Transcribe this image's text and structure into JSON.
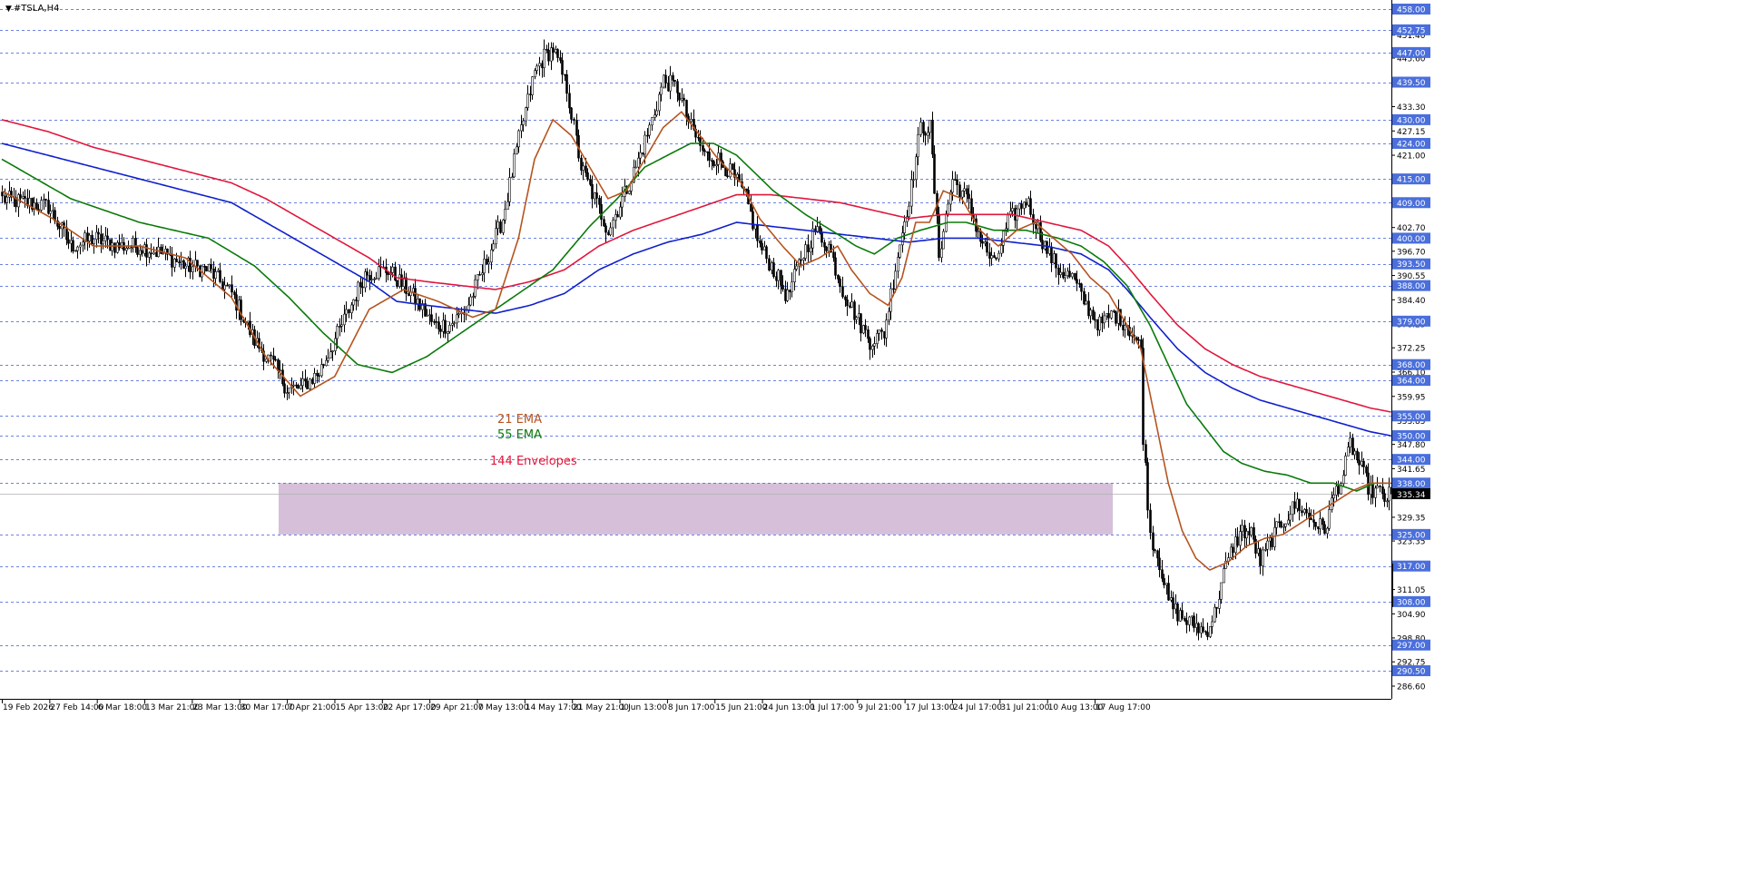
{
  "window": {
    "symbol_title": "#TSLA,H4"
  },
  "icons": {
    "title_marker": "triangle-down-icon"
  },
  "colors": {
    "background": "#ffffff",
    "grid_line": "#3b5bdb",
    "level_label_bg": "#4a6fdc",
    "level_label_text": "#ffffff",
    "candle": "#000000",
    "ema21": "#b5541f",
    "ema55": "#0a7a0a",
    "env_upper": "#e0173c",
    "env_lower": "#1020cc",
    "zone": "#d5bfd9",
    "current_price_bg": "#000000"
  },
  "chart_data": {
    "type": "candlestick",
    "symbol": "#TSLA",
    "timeframe": "H4",
    "ylim": [
      286.6,
      458.0
    ],
    "price_scale_ticks": [
      "451.40",
      "445.60",
      "433.30",
      "427.15",
      "421.00",
      "402.70",
      "396.70",
      "390.55",
      "384.40",
      "378.25",
      "372.25",
      "366.10",
      "359.95",
      "353.85",
      "347.80",
      "341.65",
      "329.35",
      "323.35",
      "311.05",
      "304.90",
      "298.80",
      "292.75",
      "286.60"
    ],
    "levels": [
      "458.00",
      "452.75",
      "447.00",
      "439.50",
      "430.00",
      "424.00",
      "415.00",
      "409.00",
      "400.00",
      "393.50",
      "388.00",
      "379.00",
      "368.00",
      "364.00",
      "355.00",
      "350.00",
      "344.00",
      "338.00",
      "325.00",
      "317.00",
      "308.00",
      "297.00",
      "290.50"
    ],
    "current_price": "335.34",
    "x_labels": [
      "19 Feb 2026",
      "27 Feb 14:00",
      "6 Mar 18:00",
      "13 Mar 21:00",
      "23 Mar 13:00",
      "30 Mar 17:00",
      "7 Apr 21:00",
      "15 Apr 13:00",
      "22 Apr 17:00",
      "29 Apr 21:00",
      "7 May 13:00",
      "14 May 17:00",
      "21 May 21:00",
      "1 Jun 13:00",
      "8 Jun 17:00",
      "15 Jun 21:00",
      "24 Jun 13:00",
      "1 Jul 17:00",
      "9 Jul 21:00",
      "17 Jul 13:00",
      "24 Jul 17:00",
      "31 Jul 21:00",
      "10 Aug 13:00",
      "17 Aug 17:00"
    ],
    "indicator_labels": [
      "21 EMA",
      "55 EMA",
      "144 Envelopes"
    ],
    "zone": {
      "low": 325.0,
      "high": 338.0
    },
    "close_anchors": [
      [
        0,
        410
      ],
      [
        20,
        408
      ],
      [
        30,
        398
      ],
      [
        40,
        400
      ],
      [
        50,
        398
      ],
      [
        60,
        398
      ],
      [
        70,
        396
      ],
      [
        80,
        393
      ],
      [
        90,
        392
      ],
      [
        100,
        386
      ],
      [
        110,
        374
      ],
      [
        118,
        368
      ],
      [
        124,
        362
      ],
      [
        130,
        362
      ],
      [
        138,
        366
      ],
      [
        148,
        378
      ],
      [
        158,
        391
      ],
      [
        168,
        392
      ],
      [
        178,
        386
      ],
      [
        188,
        378
      ],
      [
        195,
        378
      ],
      [
        202,
        382
      ],
      [
        210,
        393
      ],
      [
        218,
        405
      ],
      [
        225,
        425
      ],
      [
        232,
        442
      ],
      [
        236,
        446
      ],
      [
        240,
        448
      ],
      [
        246,
        438
      ],
      [
        252,
        418
      ],
      [
        258,
        410
      ],
      [
        264,
        402
      ],
      [
        270,
        410
      ],
      [
        276,
        418
      ],
      [
        282,
        428
      ],
      [
        288,
        440
      ],
      [
        294,
        438
      ],
      [
        300,
        428
      ],
      [
        306,
        421
      ],
      [
        312,
        420
      ],
      [
        318,
        416
      ],
      [
        324,
        410
      ],
      [
        330,
        398
      ],
      [
        336,
        392
      ],
      [
        342,
        385
      ],
      [
        348,
        395
      ],
      [
        354,
        402
      ],
      [
        360,
        398
      ],
      [
        366,
        387
      ],
      [
        372,
        380
      ],
      [
        378,
        374
      ],
      [
        384,
        376
      ],
      [
        390,
        396
      ],
      [
        396,
        413
      ],
      [
        400,
        428
      ],
      [
        404,
        428
      ],
      [
        408,
        396
      ],
      [
        414,
        415
      ],
      [
        420,
        410
      ],
      [
        426,
        400
      ],
      [
        432,
        393
      ],
      [
        438,
        404
      ],
      [
        446,
        410
      ],
      [
        454,
        398
      ],
      [
        460,
        392
      ],
      [
        466,
        390
      ],
      [
        472,
        383
      ],
      [
        478,
        378
      ],
      [
        484,
        381
      ],
      [
        490,
        378
      ],
      [
        494,
        374
      ],
      [
        496,
        372
      ],
      [
        497,
        350
      ],
      [
        500,
        325
      ],
      [
        504,
        318
      ],
      [
        508,
        308
      ],
      [
        512,
        305
      ],
      [
        516,
        303
      ],
      [
        520,
        302
      ],
      [
        524,
        300
      ],
      [
        528,
        305
      ],
      [
        532,
        315
      ],
      [
        536,
        322
      ],
      [
        540,
        326
      ],
      [
        544,
        325
      ],
      [
        548,
        318
      ],
      [
        552,
        323
      ],
      [
        556,
        327
      ],
      [
        560,
        330
      ],
      [
        564,
        333
      ],
      [
        568,
        330
      ],
      [
        572,
        328
      ],
      [
        576,
        326
      ],
      [
        580,
        335
      ],
      [
        584,
        340
      ],
      [
        587,
        348
      ],
      [
        590,
        344
      ],
      [
        593,
        340
      ],
      [
        596,
        336
      ],
      [
        599,
        336
      ],
      [
        602,
        334
      ],
      [
        605,
        335.3
      ]
    ],
    "ema21": [
      [
        0,
        412
      ],
      [
        22,
        405
      ],
      [
        40,
        398
      ],
      [
        60,
        398
      ],
      [
        80,
        395
      ],
      [
        100,
        385
      ],
      [
        115,
        370
      ],
      [
        130,
        360
      ],
      [
        145,
        365
      ],
      [
        160,
        382
      ],
      [
        175,
        387
      ],
      [
        190,
        384
      ],
      [
        205,
        380
      ],
      [
        215,
        382
      ],
      [
        225,
        400
      ],
      [
        232,
        420
      ],
      [
        240,
        430
      ],
      [
        248,
        426
      ],
      [
        256,
        418
      ],
      [
        264,
        410
      ],
      [
        272,
        412
      ],
      [
        280,
        420
      ],
      [
        288,
        428
      ],
      [
        296,
        432
      ],
      [
        304,
        426
      ],
      [
        312,
        420
      ],
      [
        322,
        414
      ],
      [
        330,
        405
      ],
      [
        340,
        398
      ],
      [
        348,
        393
      ],
      [
        356,
        395
      ],
      [
        364,
        398
      ],
      [
        370,
        392
      ],
      [
        378,
        386
      ],
      [
        386,
        383
      ],
      [
        392,
        390
      ],
      [
        398,
        404
      ],
      [
        404,
        404
      ],
      [
        410,
        412
      ],
      [
        418,
        410
      ],
      [
        426,
        402
      ],
      [
        434,
        398
      ],
      [
        442,
        402
      ],
      [
        450,
        404
      ],
      [
        458,
        400
      ],
      [
        466,
        396
      ],
      [
        474,
        390
      ],
      [
        482,
        386
      ],
      [
        490,
        378
      ],
      [
        496,
        372
      ],
      [
        502,
        355
      ],
      [
        508,
        338
      ],
      [
        514,
        326
      ],
      [
        520,
        319
      ],
      [
        526,
        316
      ],
      [
        534,
        318
      ],
      [
        542,
        322
      ],
      [
        550,
        324
      ],
      [
        558,
        325
      ],
      [
        566,
        328
      ],
      [
        574,
        331
      ],
      [
        580,
        333
      ],
      [
        588,
        336
      ],
      [
        596,
        338
      ],
      [
        605,
        338
      ]
    ],
    "ema55": [
      [
        0,
        420
      ],
      [
        30,
        410
      ],
      [
        60,
        404
      ],
      [
        90,
        400
      ],
      [
        110,
        393
      ],
      [
        125,
        385
      ],
      [
        140,
        376
      ],
      [
        155,
        368
      ],
      [
        170,
        366
      ],
      [
        185,
        370
      ],
      [
        205,
        378
      ],
      [
        220,
        384
      ],
      [
        240,
        392
      ],
      [
        256,
        403
      ],
      [
        268,
        410
      ],
      [
        280,
        418
      ],
      [
        290,
        421
      ],
      [
        300,
        424
      ],
      [
        310,
        424
      ],
      [
        320,
        421
      ],
      [
        336,
        412
      ],
      [
        350,
        406
      ],
      [
        364,
        401
      ],
      [
        372,
        398
      ],
      [
        380,
        396
      ],
      [
        390,
        400
      ],
      [
        400,
        402
      ],
      [
        412,
        404
      ],
      [
        420,
        404
      ],
      [
        432,
        402
      ],
      [
        446,
        402
      ],
      [
        460,
        400
      ],
      [
        470,
        398
      ],
      [
        480,
        394
      ],
      [
        490,
        388
      ],
      [
        500,
        378
      ],
      [
        508,
        368
      ],
      [
        516,
        358
      ],
      [
        524,
        352
      ],
      [
        532,
        346
      ],
      [
        540,
        343
      ],
      [
        550,
        341
      ],
      [
        560,
        340
      ],
      [
        570,
        338
      ],
      [
        580,
        338
      ],
      [
        590,
        336
      ],
      [
        598,
        338
      ],
      [
        605,
        338
      ]
    ],
    "env_upper": [
      [
        0,
        430
      ],
      [
        20,
        427
      ],
      [
        40,
        423
      ],
      [
        60,
        420
      ],
      [
        80,
        417
      ],
      [
        100,
        414
      ],
      [
        115,
        410
      ],
      [
        130,
        405
      ],
      [
        145,
        400
      ],
      [
        160,
        395
      ],
      [
        172,
        390
      ],
      [
        185,
        389
      ],
      [
        200,
        388
      ],
      [
        215,
        387
      ],
      [
        230,
        389
      ],
      [
        245,
        392
      ],
      [
        260,
        398
      ],
      [
        275,
        402
      ],
      [
        290,
        405
      ],
      [
        305,
        408
      ],
      [
        320,
        411
      ],
      [
        335,
        411
      ],
      [
        350,
        410
      ],
      [
        365,
        409
      ],
      [
        380,
        407
      ],
      [
        395,
        405
      ],
      [
        410,
        406
      ],
      [
        425,
        406
      ],
      [
        440,
        406
      ],
      [
        455,
        404
      ],
      [
        470,
        402
      ],
      [
        482,
        398
      ],
      [
        490,
        393
      ],
      [
        500,
        386
      ],
      [
        512,
        378
      ],
      [
        524,
        372
      ],
      [
        536,
        368
      ],
      [
        548,
        365
      ],
      [
        560,
        363
      ],
      [
        572,
        361
      ],
      [
        584,
        359
      ],
      [
        596,
        357
      ],
      [
        605,
        356
      ]
    ],
    "env_lower": [
      [
        0,
        424
      ],
      [
        20,
        421
      ],
      [
        40,
        418
      ],
      [
        60,
        415
      ],
      [
        80,
        412
      ],
      [
        100,
        409
      ],
      [
        115,
        404
      ],
      [
        130,
        399
      ],
      [
        145,
        394
      ],
      [
        160,
        389
      ],
      [
        172,
        384
      ],
      [
        185,
        383
      ],
      [
        200,
        382
      ],
      [
        215,
        381
      ],
      [
        230,
        383
      ],
      [
        245,
        386
      ],
      [
        260,
        392
      ],
      [
        275,
        396
      ],
      [
        290,
        399
      ],
      [
        305,
        401
      ],
      [
        320,
        404
      ],
      [
        335,
        403
      ],
      [
        350,
        402
      ],
      [
        365,
        401
      ],
      [
        380,
        400
      ],
      [
        395,
        399
      ],
      [
        410,
        400
      ],
      [
        425,
        400
      ],
      [
        440,
        399
      ],
      [
        455,
        398
      ],
      [
        470,
        396
      ],
      [
        482,
        392
      ],
      [
        490,
        387
      ],
      [
        500,
        380
      ],
      [
        512,
        372
      ],
      [
        524,
        366
      ],
      [
        536,
        362
      ],
      [
        548,
        359
      ],
      [
        560,
        357
      ],
      [
        572,
        355
      ],
      [
        584,
        353
      ],
      [
        596,
        351
      ],
      [
        605,
        350
      ]
    ]
  }
}
